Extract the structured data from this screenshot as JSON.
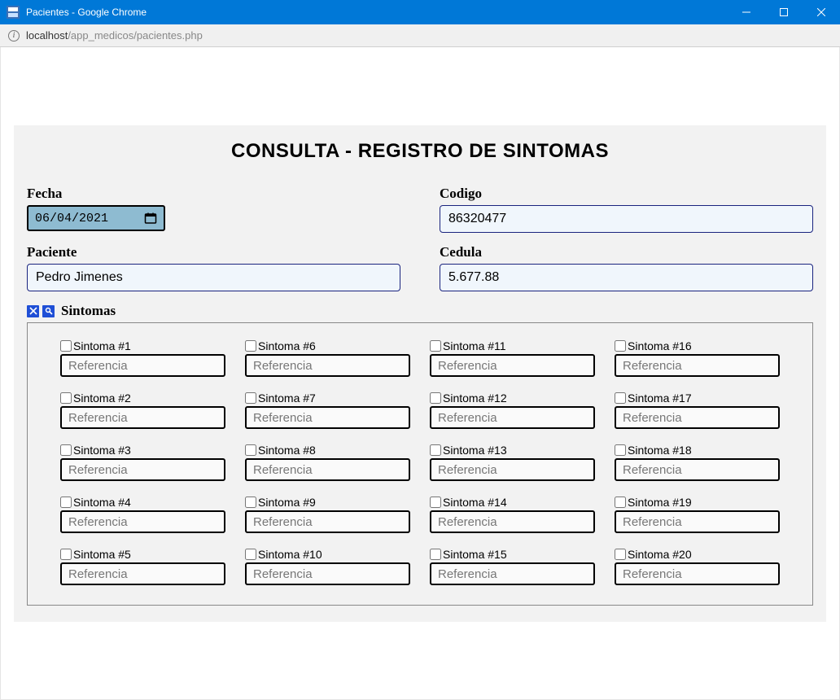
{
  "window": {
    "title": "Pacientes - Google Chrome"
  },
  "address": {
    "host": "localhost",
    "path": "/app_medicos/pacientes.php"
  },
  "page": {
    "title": "CONSULTA - REGISTRO DE SINTOMAS"
  },
  "fields": {
    "fecha": {
      "label": "Fecha",
      "value": "06/04/2021"
    },
    "codigo": {
      "label": "Codigo",
      "value": "86320477"
    },
    "paciente": {
      "label": "Paciente",
      "value": "Pedro Jimenes"
    },
    "cedula": {
      "label": "Cedula",
      "value": "5.677.88"
    }
  },
  "sintomas": {
    "title": "Sintomas",
    "ref_placeholder": "Referencia",
    "items": [
      {
        "label": "Sintoma #1"
      },
      {
        "label": "Sintoma #2"
      },
      {
        "label": "Sintoma #3"
      },
      {
        "label": "Sintoma #4"
      },
      {
        "label": "Sintoma #5"
      },
      {
        "label": "Sintoma #6"
      },
      {
        "label": "Sintoma #7"
      },
      {
        "label": "Sintoma #8"
      },
      {
        "label": "Sintoma #9"
      },
      {
        "label": "Sintoma #10"
      },
      {
        "label": "Sintoma #11"
      },
      {
        "label": "Sintoma #12"
      },
      {
        "label": "Sintoma #13"
      },
      {
        "label": "Sintoma #14"
      },
      {
        "label": "Sintoma #15"
      },
      {
        "label": "Sintoma #16"
      },
      {
        "label": "Sintoma #17"
      },
      {
        "label": "Sintoma #18"
      },
      {
        "label": "Sintoma #19"
      },
      {
        "label": "Sintoma #20"
      }
    ]
  }
}
